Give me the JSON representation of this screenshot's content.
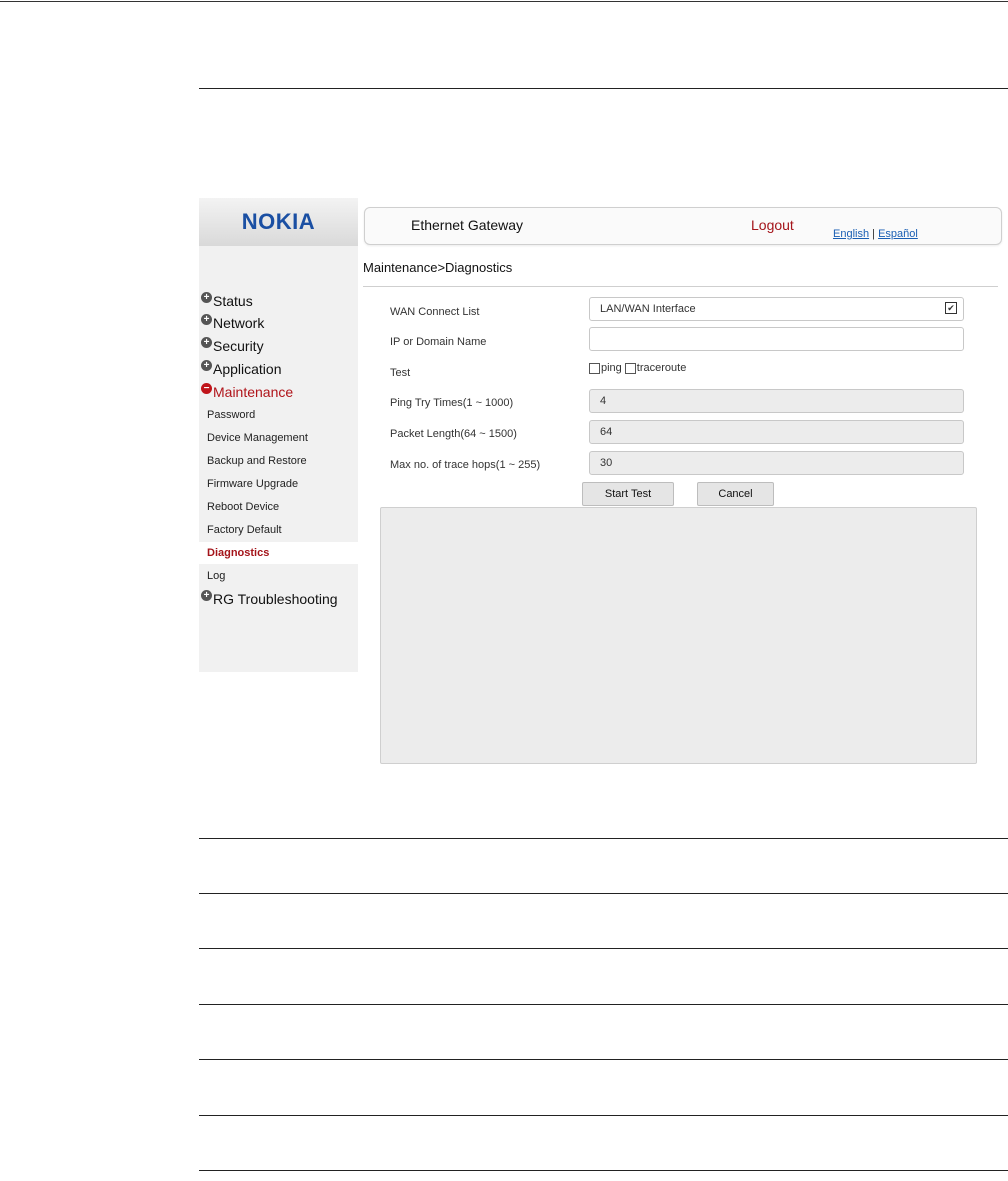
{
  "brand": {
    "logo_text": "NOKIA",
    "color": "#1a4fa3"
  },
  "header": {
    "product_name": "Ethernet Gateway",
    "logout_label": "Logout",
    "lang_english": "English",
    "lang_separator": "|",
    "lang_spanish": "Español"
  },
  "sidebar": {
    "top_items": [
      {
        "label": "Status",
        "icon": "plus-icon"
      },
      {
        "label": "Network",
        "icon": "plus-icon"
      },
      {
        "label": "Security",
        "icon": "plus-icon"
      },
      {
        "label": "Application",
        "icon": "plus-icon"
      },
      {
        "label": "Maintenance",
        "icon": "minus-icon"
      },
      {
        "label": "RG Troubleshooting",
        "icon": "plus-icon"
      }
    ],
    "sub_items": [
      {
        "label": "Password"
      },
      {
        "label": "Device Management"
      },
      {
        "label": "Backup and Restore"
      },
      {
        "label": "Firmware Upgrade"
      },
      {
        "label": "Reboot Device"
      },
      {
        "label": "Factory Default"
      },
      {
        "label": "Diagnostics",
        "selected": true
      },
      {
        "label": "Log"
      }
    ]
  },
  "breadcrumb": "Maintenance>Diagnostics",
  "form": {
    "wan_label": "WAN Connect List",
    "wan_value": "LAN/WAN Interface",
    "ip_label": "IP or Domain Name",
    "ip_value": "",
    "test_label": "Test",
    "ping_label": "ping",
    "traceroute_label": "traceroute",
    "ping_times_label": "Ping Try Times(1 ~ 1000)",
    "ping_times_value": "4",
    "packet_length_label": "Packet Length(64 ~ 1500)",
    "packet_length_value": "64",
    "max_hops_label": "Max no. of trace hops(1 ~ 255)",
    "max_hops_value": "30",
    "start_label": "Start Test",
    "cancel_label": "Cancel"
  },
  "colors": {
    "accent_red": "#a4141a",
    "link_blue": "#1a5fb4",
    "sidebar_bg": "#f1f1f1"
  }
}
